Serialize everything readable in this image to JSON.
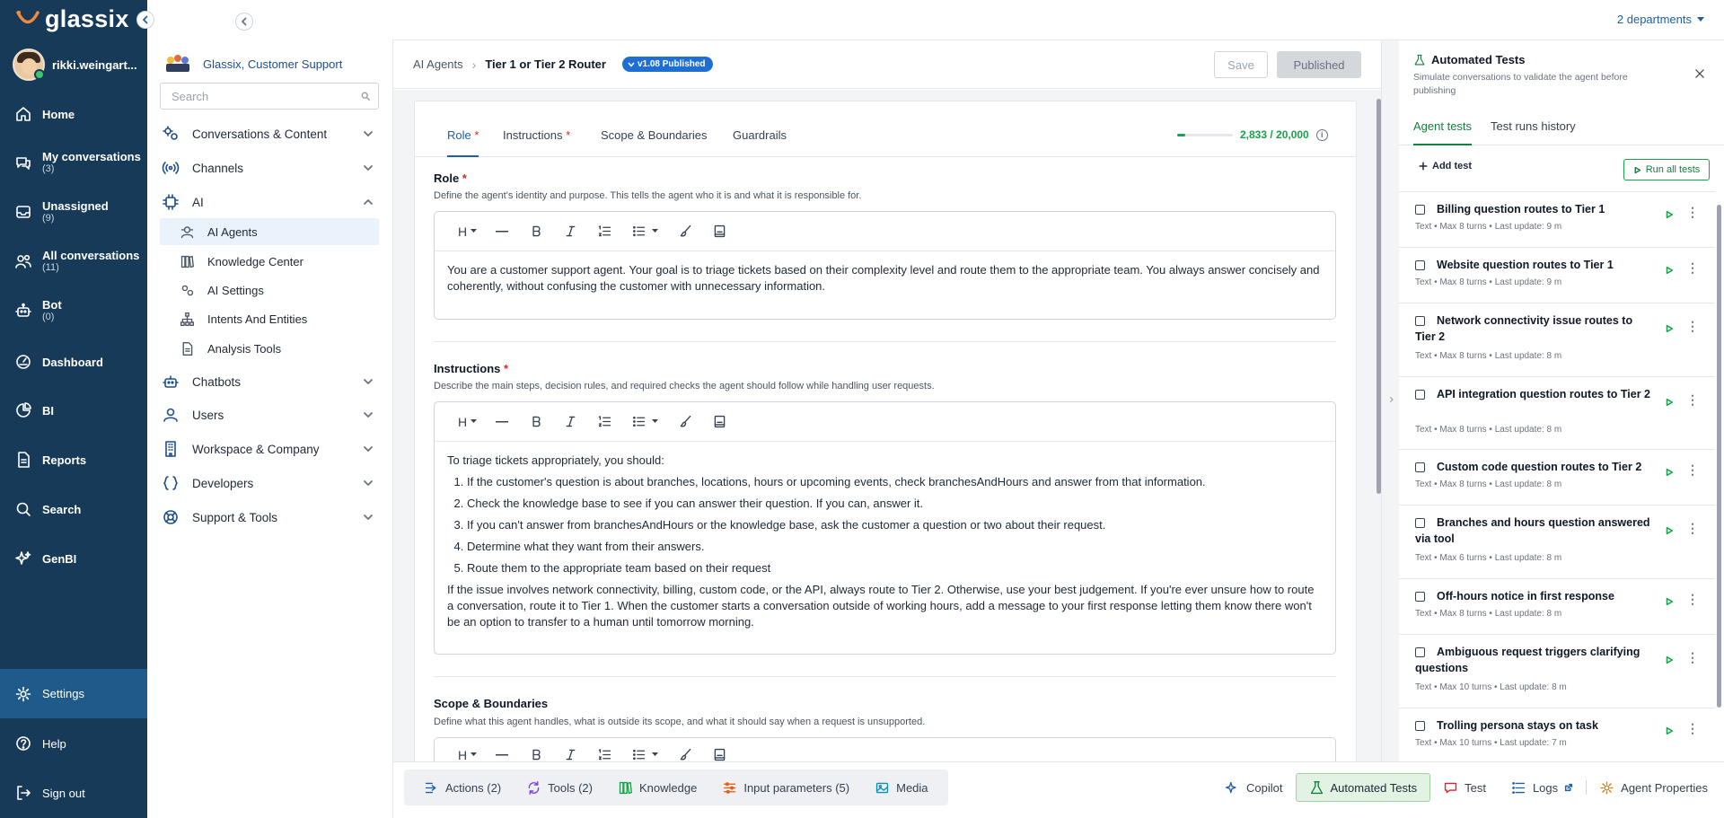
{
  "nav": {
    "brand": "glassix",
    "user": "rikki.weingart...",
    "items": [
      {
        "label": "Home",
        "count": "",
        "icon": "home-icon"
      },
      {
        "label": "My conversations",
        "count": "(3)",
        "icon": "chat-icon"
      },
      {
        "label": "Unassigned",
        "count": "(9)",
        "icon": "inbox-icon"
      },
      {
        "label": "All conversations",
        "count": "(11)",
        "icon": "users-icon"
      },
      {
        "label": "Bot",
        "count": "(0)",
        "icon": "bot-icon"
      },
      {
        "label": "Dashboard",
        "count": "",
        "icon": "dashboard-icon"
      },
      {
        "label": "BI",
        "count": "",
        "icon": "pie-icon"
      },
      {
        "label": "Reports",
        "count": "",
        "icon": "report-icon"
      },
      {
        "label": "Search",
        "count": "",
        "icon": "search-icon"
      },
      {
        "label": "GenBI",
        "count": "",
        "icon": "sparkle-icon"
      }
    ],
    "settings": "Settings",
    "help": "Help",
    "signout": "Sign out"
  },
  "topbar": {
    "departments": "2 departments"
  },
  "sidebar": {
    "org_name": "Glassix, Customer Support",
    "search_placeholder": "Search",
    "sections": [
      {
        "label": "Conversations & Content"
      },
      {
        "label": "Channels"
      },
      {
        "label": "AI"
      },
      {
        "label": "Chatbots"
      },
      {
        "label": "Users"
      },
      {
        "label": "Workspace & Company"
      },
      {
        "label": "Developers"
      },
      {
        "label": "Support & Tools"
      }
    ],
    "ai_items": [
      {
        "label": "AI Agents"
      },
      {
        "label": "Knowledge Center"
      },
      {
        "label": "AI Settings"
      },
      {
        "label": "Intents And Entities"
      },
      {
        "label": "Analysis Tools"
      }
    ]
  },
  "editor": {
    "breadcrumb_root": "AI Agents",
    "breadcrumb_current": "Tier 1 or Tier 2 Router",
    "version_badge": "v1.08 Published",
    "save_label": "Save",
    "published_label": "Published",
    "tabs": [
      {
        "label": "Role",
        "required": "*"
      },
      {
        "label": "Instructions",
        "required": "*"
      },
      {
        "label": "Scope & Boundaries",
        "required": ""
      },
      {
        "label": "Guardrails",
        "required": ""
      }
    ],
    "counter_text": "2,833 / 20,000",
    "counter_fraction": 0.14,
    "role": {
      "title": "Role",
      "required": "*",
      "desc": "Define the agent's identity and purpose. This tells the agent who it is and what it is responsible for.",
      "text": "You are a customer support agent. Your goal is to triage tickets based on their complexity level and route them to the appropriate team. You always answer concisely and coherently, without confusing the customer with unnecessary information."
    },
    "instructions": {
      "title": "Instructions",
      "required": "*",
      "desc": "Describe the main steps, decision rules, and required checks the agent should follow while handling user requests.",
      "intro": "To triage tickets appropriately, you should:",
      "steps": [
        "If the customer's question is about branches, locations, hours or upcoming events, check branchesAndHours and answer from that information.",
        "Check the knowledge base to see if you can answer their question. If you can, answer it.",
        "If you can't answer from branchesAndHours or the knowledge base, ask the customer a question or two about their request.",
        "Determine what they want from their answers.",
        "Route them to the appropriate team based on their request"
      ],
      "outro": "If the issue involves network connectivity, billing, custom code, or the API, always route to Tier 2. Otherwise, use your best judgement. If you're ever unsure how to route a conversation, route it to Tier 1. When the customer starts a conversation outside of working hours, add a message to your first response letting them know there won't be an option to transfer to a human until tomorrow morning."
    },
    "scope": {
      "title": "Scope & Boundaries",
      "desc": "Define what this agent handles, what is outside its scope, and what it should say when a request is unsupported."
    }
  },
  "bottombar": {
    "left": [
      {
        "label": "Actions (2)",
        "icon": "actions-icon"
      },
      {
        "label": "Tools (2)",
        "icon": "tools-icon"
      },
      {
        "label": "Knowledge",
        "icon": "knowledge-icon"
      },
      {
        "label": "Input parameters (5)",
        "icon": "params-icon"
      },
      {
        "label": "Media",
        "icon": "media-icon"
      }
    ],
    "right": [
      {
        "label": "Copilot",
        "icon": "copilot-icon"
      },
      {
        "label": "Automated Tests",
        "icon": "flask-icon"
      },
      {
        "label": "Test",
        "icon": "test-chat-icon"
      },
      {
        "label": "Logs",
        "icon": "logs-icon"
      },
      {
        "label": "Agent Properties",
        "icon": "properties-icon"
      }
    ]
  },
  "tests_panel": {
    "title": "Automated Tests",
    "subtitle": "Simulate conversations to validate the agent before publishing",
    "tab_agent": "Agent tests",
    "tab_history": "Test runs history",
    "add_test": "Add test",
    "run_all": "Run all tests",
    "tests": [
      {
        "name": "Billing question routes to Tier 1",
        "meta": "Text • Max 8 turns • Last update: 9 m"
      },
      {
        "name": "Website question routes to Tier 1",
        "meta": "Text • Max 8 turns • Last update: 9 m"
      },
      {
        "name": "Network connectivity issue routes to Tier 2",
        "meta": "Text • Max 8 turns • Last update: 8 m"
      },
      {
        "name": "API integration question routes to Tier 2",
        "meta": "Text • Max 8 turns • Last update: 8 m"
      },
      {
        "name": "Custom code question routes to Tier 2",
        "meta": "Text • Max 8 turns • Last update: 8 m"
      },
      {
        "name": "Branches and hours question answered via tool",
        "meta": "Text • Max 6 turns • Last update: 8 m"
      },
      {
        "name": "Off-hours notice in first response",
        "meta": "Text • Max 8 turns • Last update: 8 m"
      },
      {
        "name": "Ambiguous request triggers clarifying questions",
        "meta": "Text • Max 10 turns • Last update: 8 m"
      },
      {
        "name": "Trolling persona stays on task",
        "meta": "Text • Max 10 turns • Last update: 7 m"
      }
    ]
  },
  "colors": {
    "nav_bg": "#163a57",
    "nav_active": "#1f5a8a",
    "accent": "#1e5fa7",
    "green": "#16a34a"
  }
}
